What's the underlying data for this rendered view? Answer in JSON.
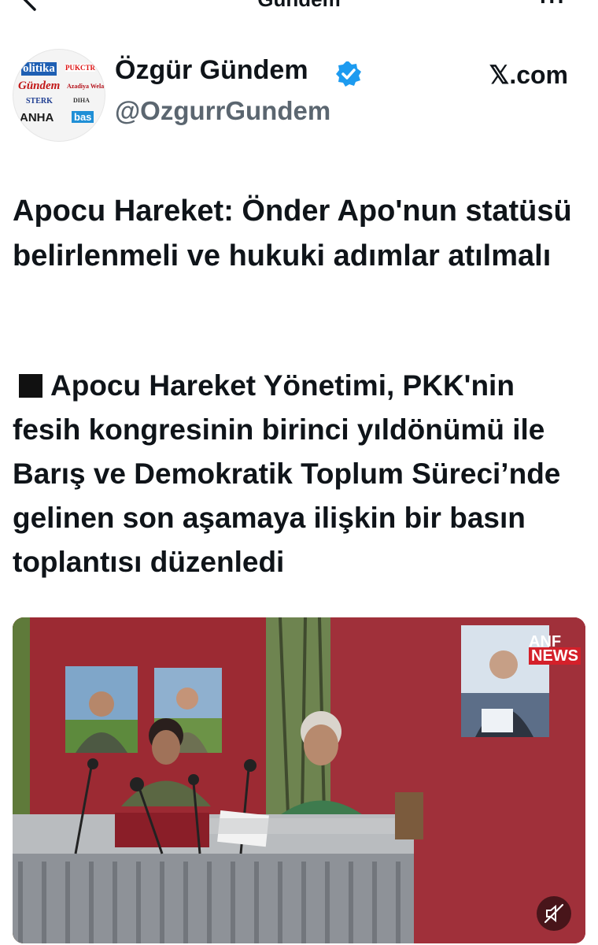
{
  "topbar": {
    "title": "Gündem",
    "back_icon": "back-arrow-icon",
    "more_icon": "more-icon",
    "more_glyph": "···"
  },
  "author": {
    "name": "Özgür Gündem",
    "handle": "@OzgurrGundem",
    "verified_icon": "verified-badge-icon",
    "avatar_logos": [
      "olitika",
      "PUKCTR",
      "Gündem",
      "Azadiya Wela",
      "STERK",
      "DIHA",
      "ANHA",
      "bas"
    ]
  },
  "source": {
    "label": "𝕏.com"
  },
  "post": {
    "headline": "Apocu Hareket: Önder Apo'nun statüsü belirlenmeli ve hukuki adımlar atılmalı",
    "body": "Apocu Hareket Yönetimi, PKK'nin fesih kongresinin birinci yıldönümü ile Barış ve Demokratik Toplum Süreci’nde gelinen son aşamaya ilişkin bir basın toplantısı düzenledi"
  },
  "media": {
    "watermark_top": "ANF",
    "watermark_bottom": "NEWS",
    "mute_icon": "mute-icon"
  },
  "colors": {
    "verified": "#1d9bf0",
    "backdrop_red": "#9c2a33",
    "anf_red": "#d4202a"
  }
}
